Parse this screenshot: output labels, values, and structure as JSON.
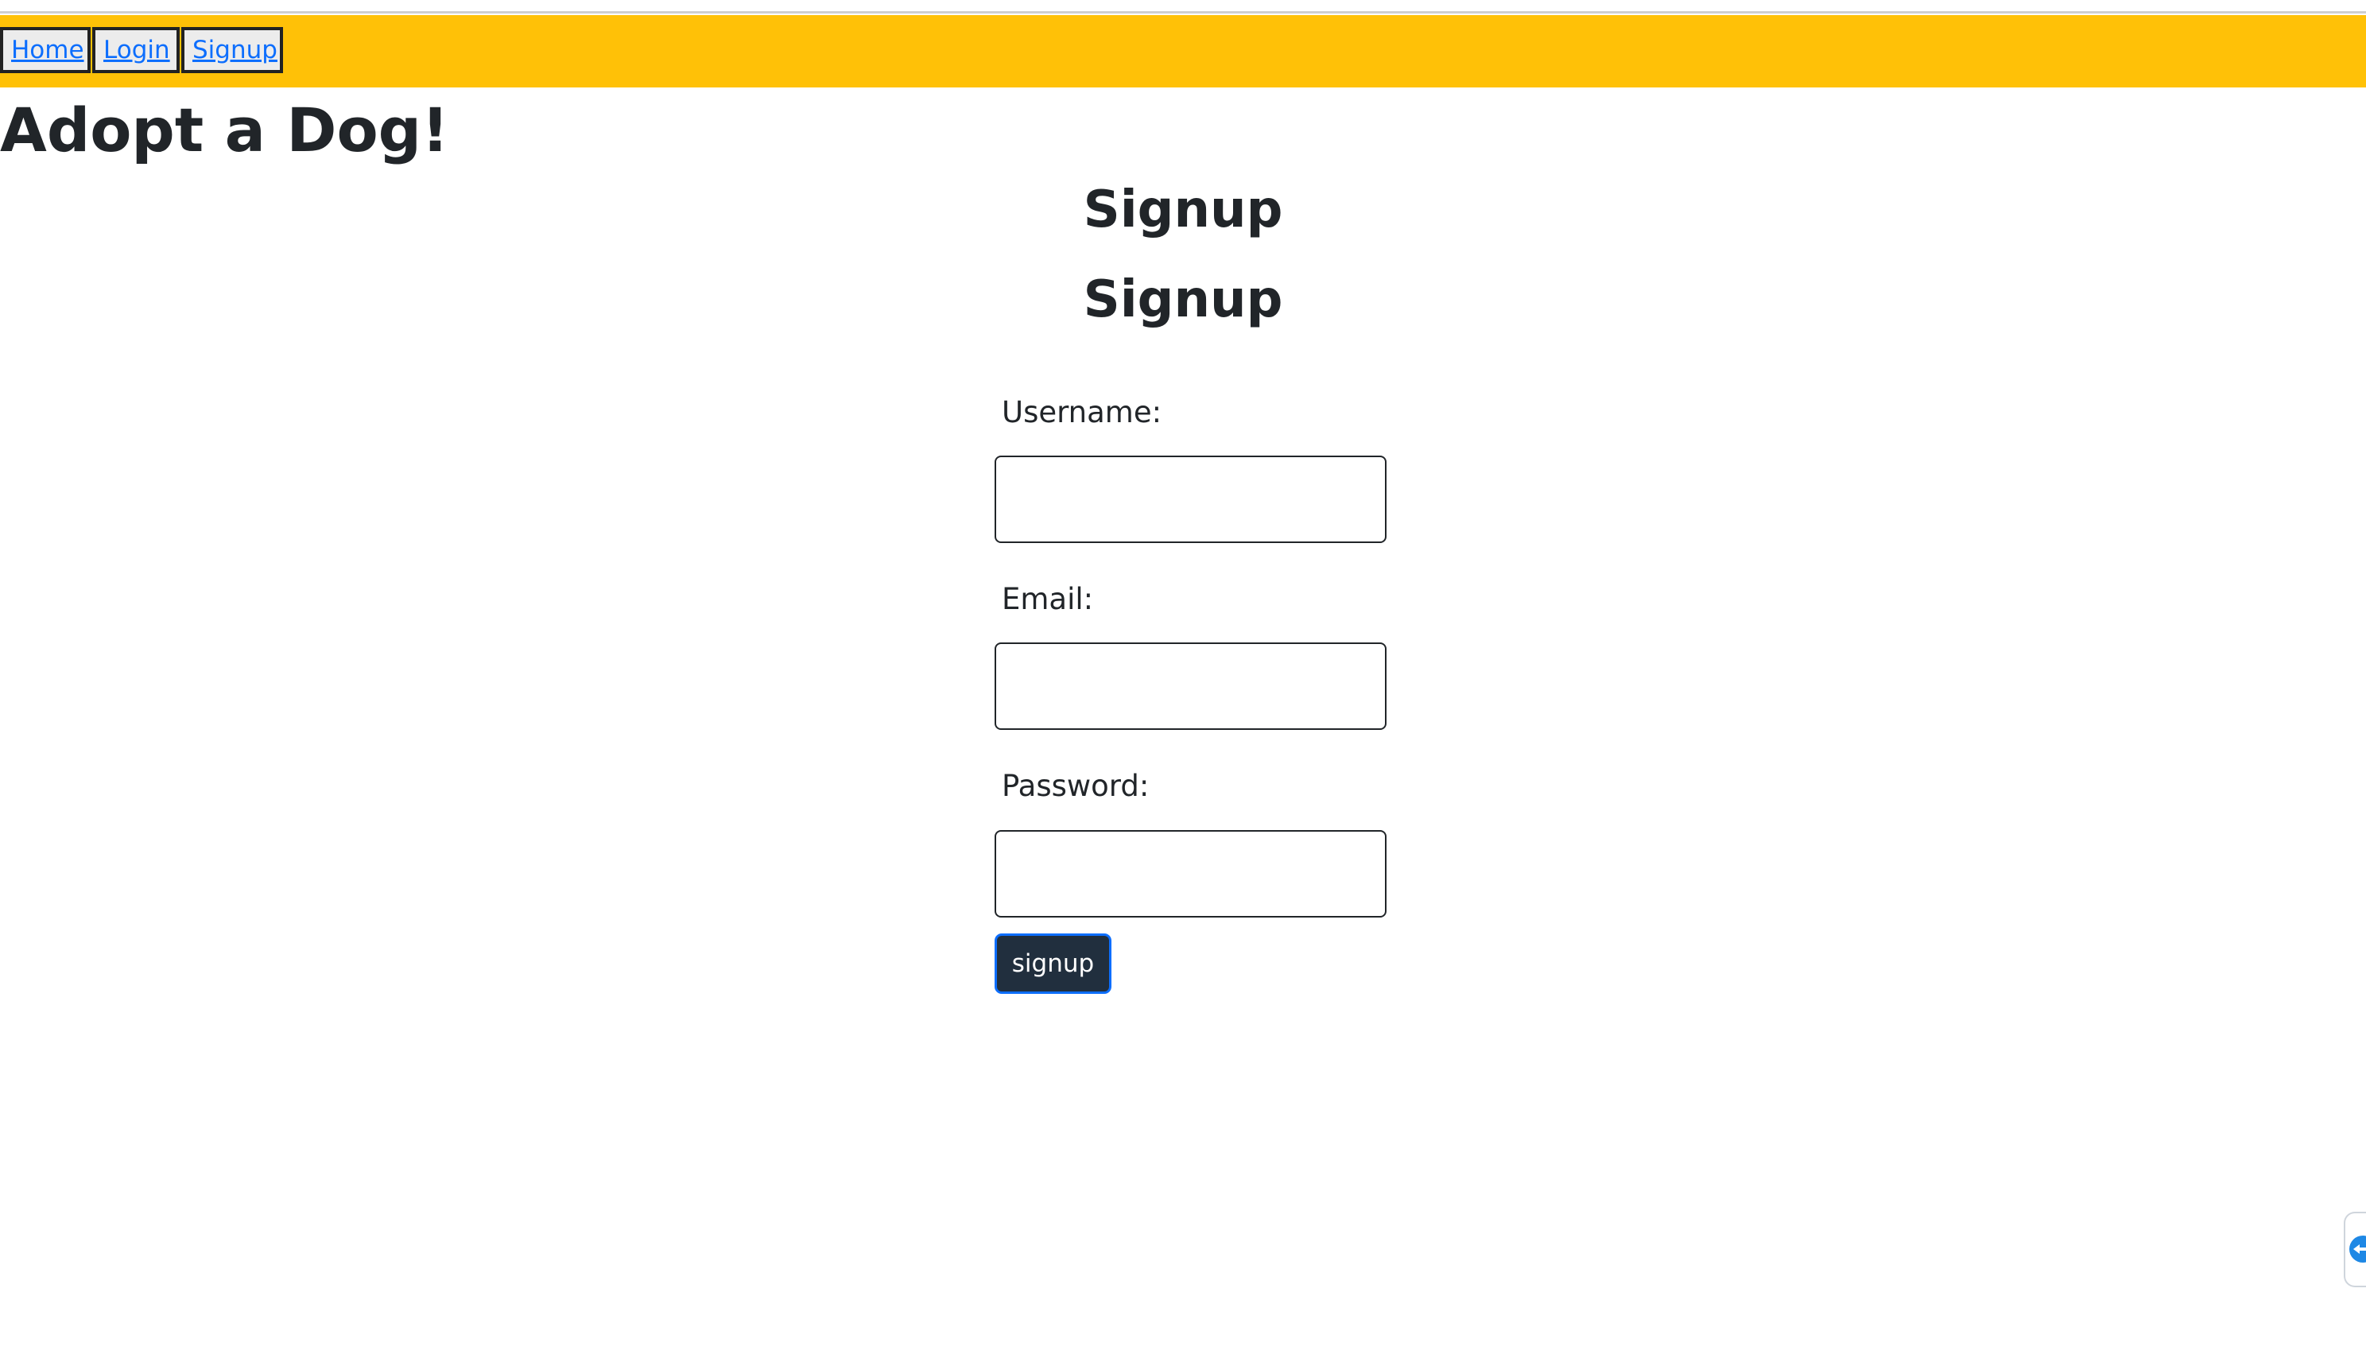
{
  "nav": {
    "home_label": "Home",
    "login_label": "Login",
    "signup_label": "Signup"
  },
  "site": {
    "title": "Adopt a Dog!"
  },
  "page": {
    "title": "Signup",
    "form_title": "Signup"
  },
  "form": {
    "username_label": "Username:",
    "username_value": "",
    "email_label": "Email:",
    "email_value": "",
    "password_label": "Password:",
    "password_value": "",
    "submit_label": "signup"
  },
  "side_widget": {
    "icon": "remote-support-icon"
  },
  "colors": {
    "navbar": "#ffc107",
    "link": "#0d6efd",
    "button": "#212f3e",
    "text": "#212529"
  }
}
